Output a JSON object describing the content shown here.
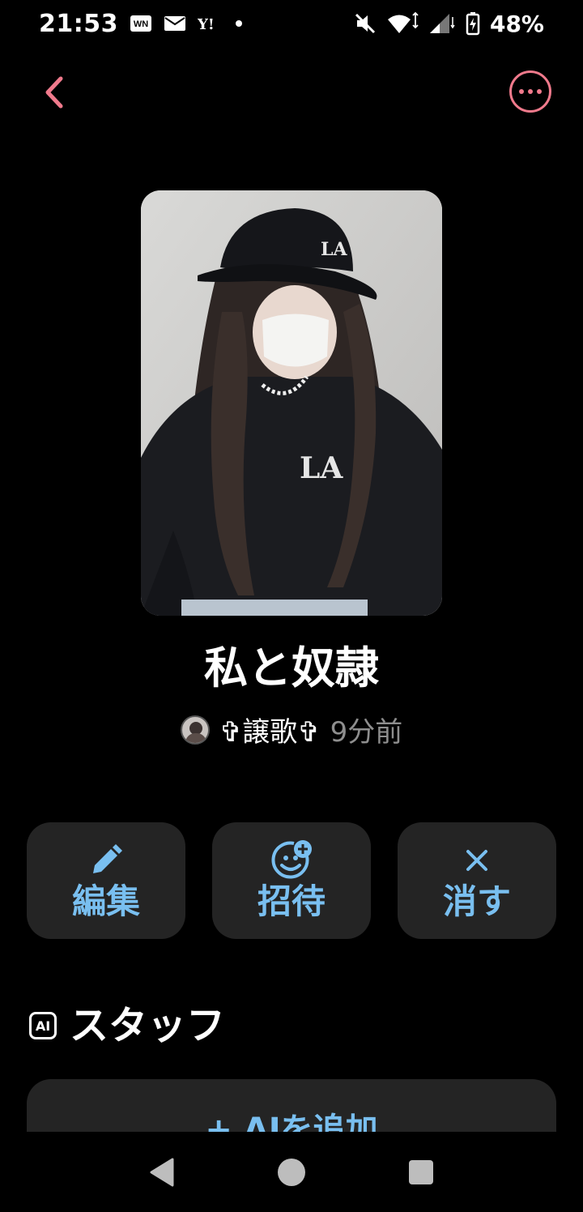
{
  "status_bar": {
    "time": "21:53",
    "notification_icons": [
      "weathernews-icon",
      "au-mail-icon",
      "yahoo-icon",
      "more-dot-icon"
    ],
    "battery": "48%"
  },
  "room": {
    "title": "私と奴隷",
    "author": "✞譲歌✞",
    "time_ago": "9分前"
  },
  "actions": [
    {
      "label": "編集",
      "icon": "pencil-icon"
    },
    {
      "label": "招待",
      "icon": "add-person-icon"
    },
    {
      "label": "消す",
      "icon": "close-icon"
    }
  ],
  "staff": {
    "badge": "AI",
    "title": "スタッフ",
    "add_label": "+ AIを追加"
  },
  "colors": {
    "accent_pink": "#f07a8c",
    "accent_blue": "#79bff0",
    "card_bg": "#242424",
    "bg": "#000000"
  }
}
